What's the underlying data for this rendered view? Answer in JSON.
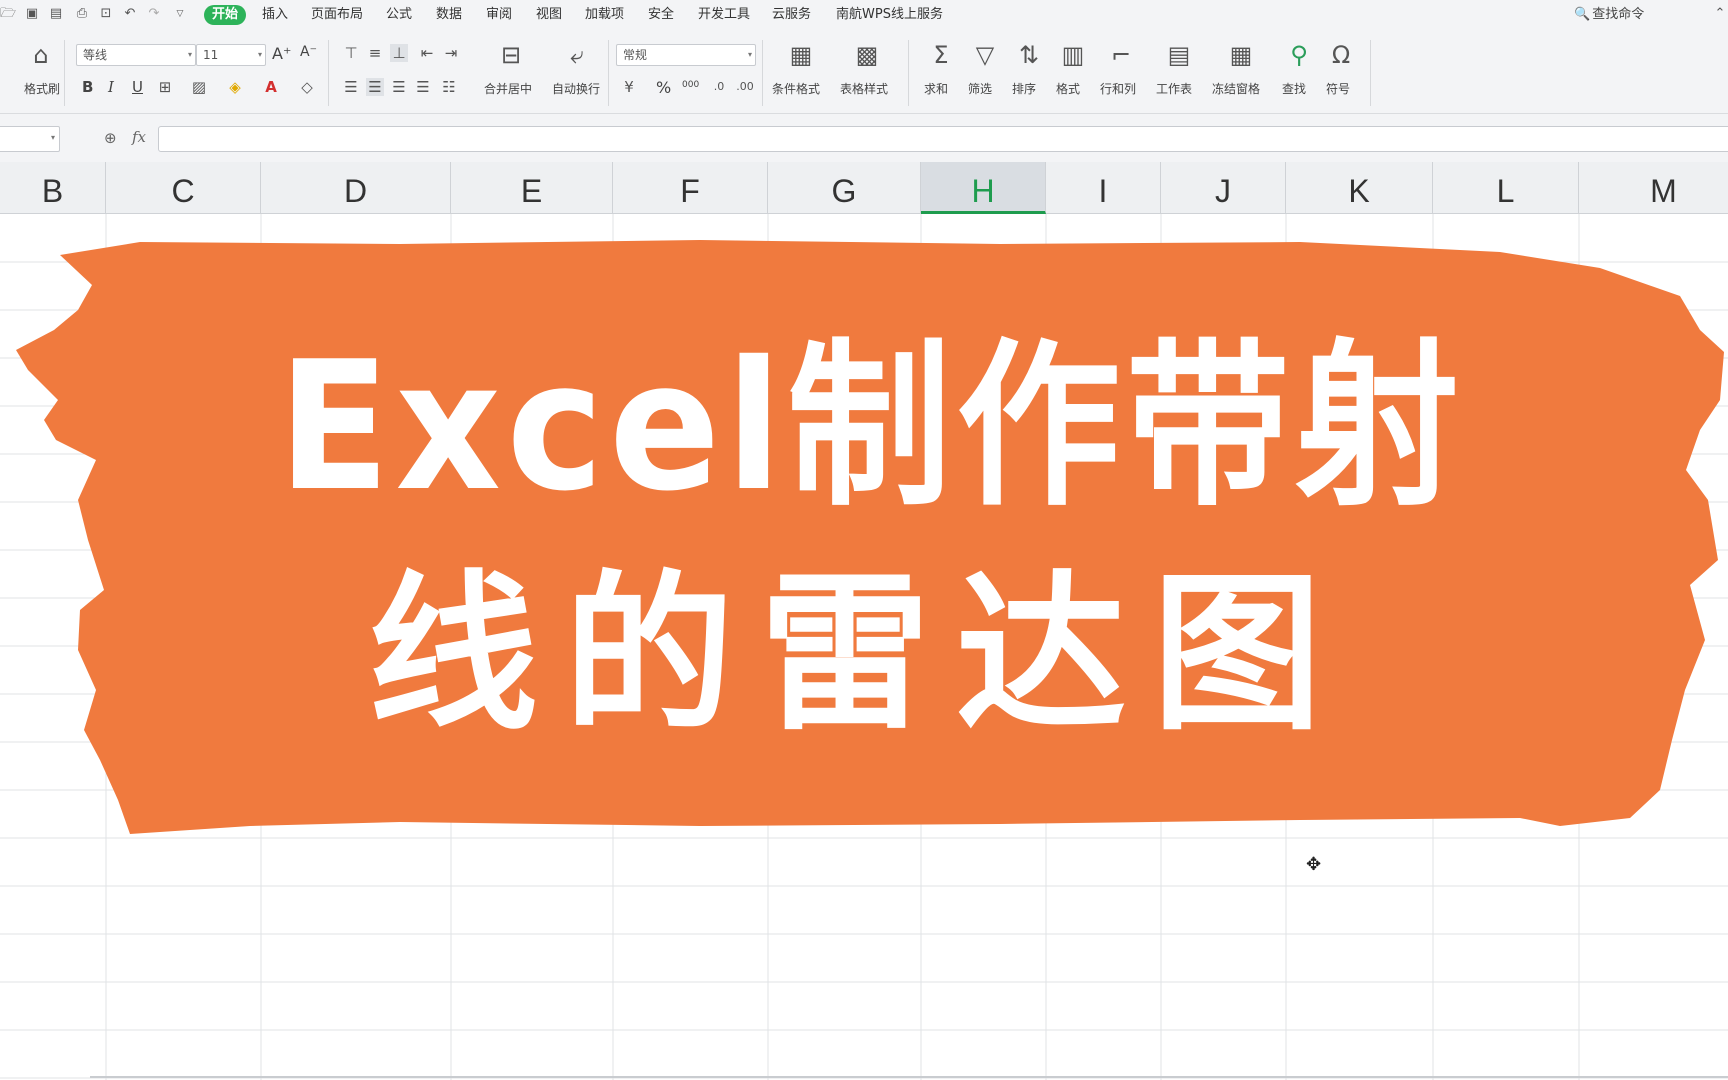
{
  "menu": {
    "tabs": [
      "开始",
      "插入",
      "页面布局",
      "公式",
      "数据",
      "审阅",
      "视图",
      "加载项",
      "安全",
      "开发工具",
      "云服务",
      "南航WPS线上服务"
    ],
    "active_tab": "开始",
    "search_label": "查找命令"
  },
  "ribbon": {
    "format_painter": "格式刷",
    "font_name": "等线",
    "font_size": "11",
    "font_buttons": [
      "B",
      "I",
      "U"
    ],
    "grow_font": "A⁺",
    "shrink_font": "A⁻",
    "merge_center": "合并居中",
    "wrap_text": "自动换行",
    "number_format": "常规",
    "percent": "%",
    "thousands": "000",
    "cond_format": "条件格式",
    "table_style": "表格样式",
    "sum": "求和",
    "filter": "筛选",
    "sort": "排序",
    "format": "格式",
    "row_col": "行和列",
    "worksheet": "工作表",
    "freeze": "冻结窗格",
    "find": "查找",
    "symbol": "符号"
  },
  "formula_bar": {
    "fx_label": "fx",
    "value": ""
  },
  "columns": [
    "B",
    "C",
    "D",
    "E",
    "F",
    "G",
    "H",
    "I",
    "J",
    "K",
    "L",
    "M"
  ],
  "selected_column": "H",
  "banner": {
    "line1": "Excel制作带射",
    "line2": "线的雷达图",
    "brush_color": "#f07a3e"
  }
}
